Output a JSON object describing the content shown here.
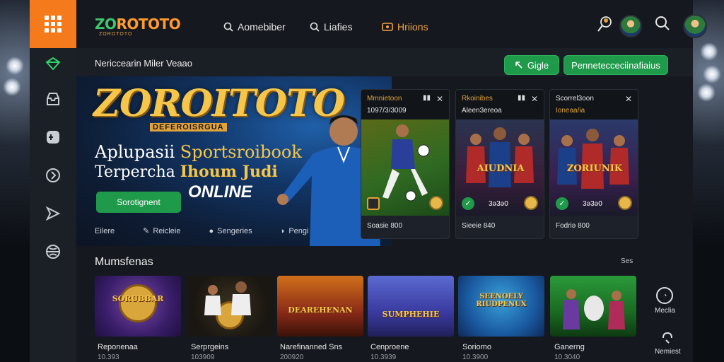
{
  "status": {
    "icons": [
      "wifi-icon",
      "signal-icon",
      "battery-icon",
      "close-icon"
    ]
  },
  "brand": {
    "name_z": "ZO",
    "name_rest": "ROTOTO",
    "tagline": "ZOROTOTO"
  },
  "nav": {
    "items": [
      {
        "label": "Aomebiber",
        "icon": "search-icon"
      },
      {
        "label": "Liafies",
        "icon": "search-icon"
      },
      {
        "label": "Hriions",
        "icon": "ticket-icon",
        "active": true
      }
    ]
  },
  "subheader": {
    "title": "Nericcearin Miler Veaao",
    "btn_login": "Gigle",
    "btn_register": "Pennetecceciinafiaius"
  },
  "hero": {
    "logo": "ZOROITOTO",
    "logo_sub": "DEFEROISRGUA",
    "line1_a": "Aplupasii ",
    "line1_b": "Sportsroibook",
    "line2_a": "Terpercha ",
    "line2_b": "Ihoum Judi",
    "line3": "ONLINE",
    "cta": "Sorotignent",
    "links": [
      {
        "label": "Eilere",
        "icon": ""
      },
      {
        "label": "Reicleie",
        "icon": "tool-icon"
      },
      {
        "label": "Sengeries",
        "icon": "dot-icon"
      },
      {
        "label": "Pengi",
        "icon": "shield-icon"
      }
    ]
  },
  "match_cards": [
    {
      "title": "Mmnietoon",
      "subtitle": "1097/3/3009",
      "odds": "",
      "footer": "Soasie  800",
      "banner": ""
    },
    {
      "title": "Rkoinibes",
      "subtitle": "Aleen3ereoa",
      "odds": "3ə3ə0",
      "footer": "Sieeie  840",
      "banner": "AIUDNIA"
    },
    {
      "title": "Scorrel3oon",
      "subtitle": "Ioneaa/ia",
      "odds": "3ə3ə0",
      "footer": "Fodriə  800",
      "banner": "ZORIUNIK"
    }
  ],
  "section": {
    "title": "Mumsfenas",
    "more": "Ses"
  },
  "games": [
    {
      "name": "Reponenaa",
      "value": "10.393",
      "label": "SORUBBAR"
    },
    {
      "name": "Serprgeins",
      "value": "103909",
      "label": ""
    },
    {
      "name": "Narefinanned Sns",
      "value": "200920",
      "label": "DEAREHENAN"
    },
    {
      "name": "Cenproene",
      "value": "10.3939",
      "label": "SUMPHEHIE"
    },
    {
      "name": "Soriomo",
      "value": "10.3900",
      "label": "SEENOELY RIUDPENUX"
    },
    {
      "name": "Ganerng",
      "value": "10.3040",
      "label": ""
    }
  ],
  "right_actions": [
    {
      "label": "Meclia",
      "icon": "compass-icon"
    },
    {
      "label": "Nemiest",
      "icon": "support-icon"
    }
  ],
  "colors": {
    "accent": "#f47a1c",
    "green": "#1f9a4a",
    "gold": "#f6c64a"
  }
}
